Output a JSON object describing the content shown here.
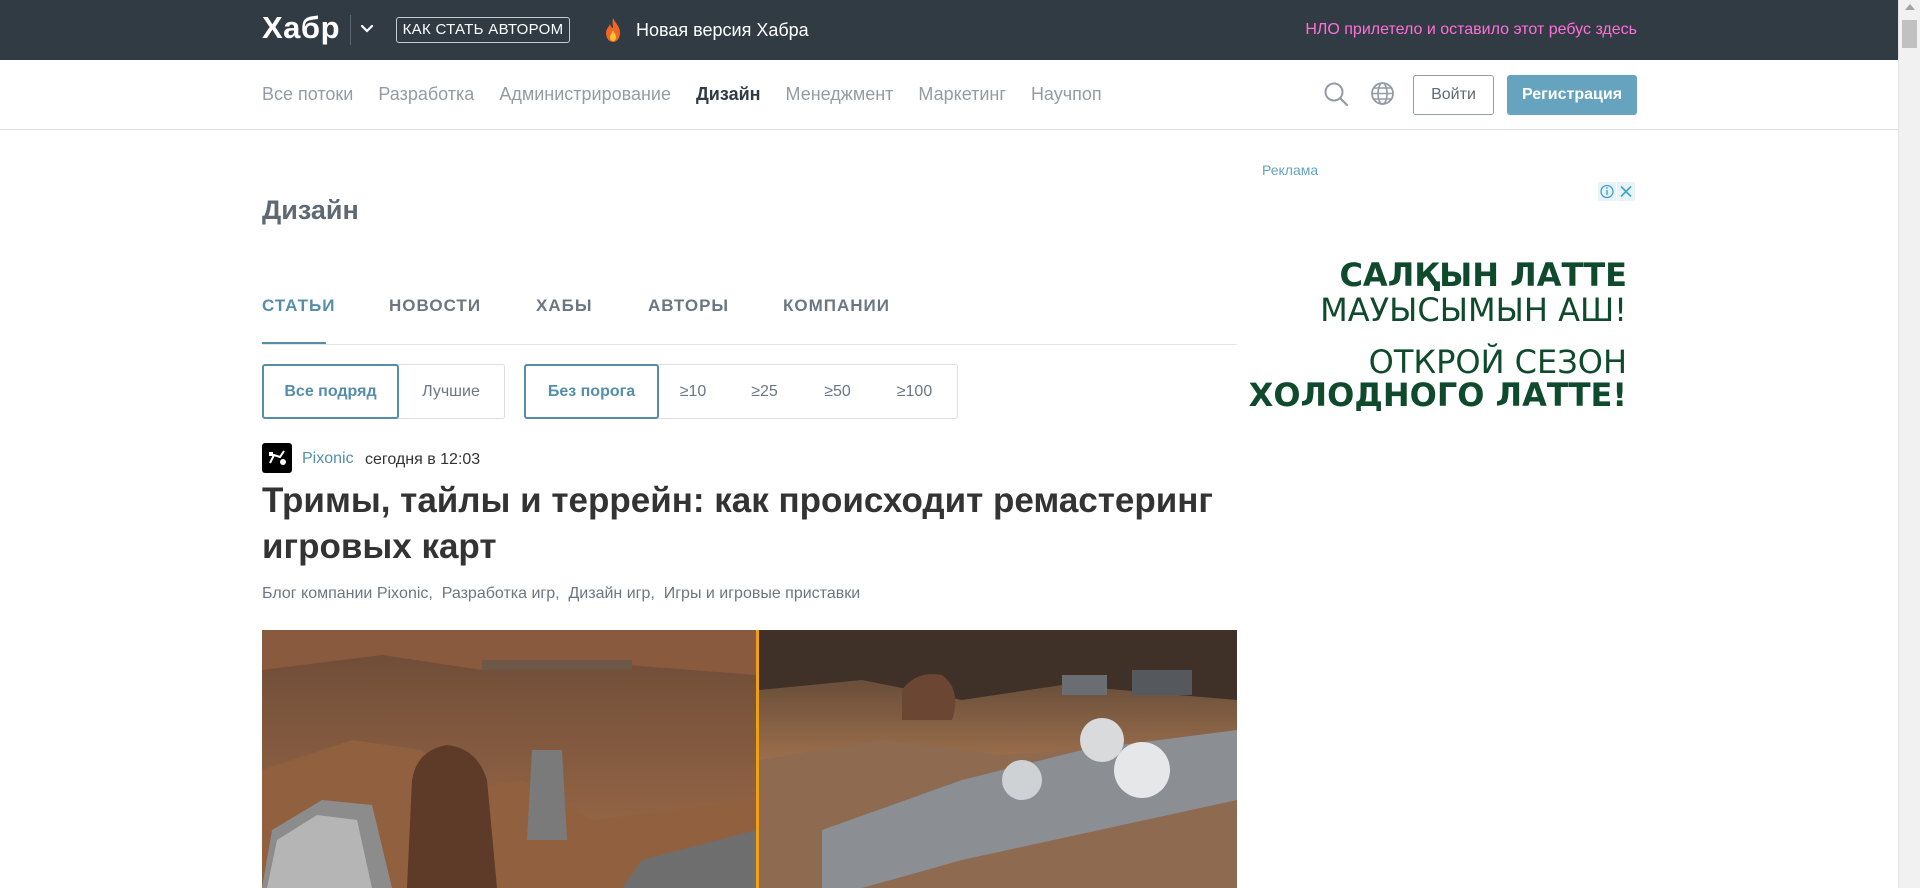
{
  "topbar": {
    "logo": "Хабр",
    "author_button": "КАК СТАТЬ АВТОРОМ",
    "new_version": "Новая версия Хабра",
    "ufo_link": "НЛО прилетело и оставило этот ребус здесь"
  },
  "nav": {
    "items": [
      "Все потоки",
      "Разработка",
      "Администрирование",
      "Дизайн",
      "Менеджмент",
      "Маркетинг",
      "Научпоп"
    ],
    "active": "Дизайн",
    "login": "Войти",
    "register": "Регистрация"
  },
  "page": {
    "title": "Дизайн",
    "tabs": [
      "СТАТЬИ",
      "НОВОСТИ",
      "ХАБЫ",
      "АВТОРЫ",
      "КОМПАНИИ"
    ],
    "active_tab": "СТАТЬИ",
    "filters_sort": [
      "Все подряд",
      "Лучшие"
    ],
    "filters_rating": [
      "Без порога",
      "≥10",
      "≥25",
      "≥50",
      "≥100"
    ]
  },
  "article": {
    "author": "Pixonic",
    "time": "сегодня в 12:03",
    "title": "Тримы, тайлы и террейн: как происходит ремастеринг игровых карт",
    "hubs": [
      "Блог компании Pixonic,",
      "Разработка игр,",
      "Дизайн игр,",
      "Игры и игровые приставки"
    ]
  },
  "ad": {
    "label": "Реклама",
    "lines": [
      "САЛҚЫН ЛАТТЕ",
      "МАУЫСЫМЫН АШ!",
      "ОТКРОЙ СЕЗОН",
      "ХОЛОДНОГО ЛАТТЕ!"
    ]
  },
  "colors": {
    "topbar_bg": "#303b44",
    "accent": "#548eaa",
    "register_bg": "#65a3be",
    "ufo_link": "#ff6fd8",
    "ad_text": "#0f4a2c"
  }
}
